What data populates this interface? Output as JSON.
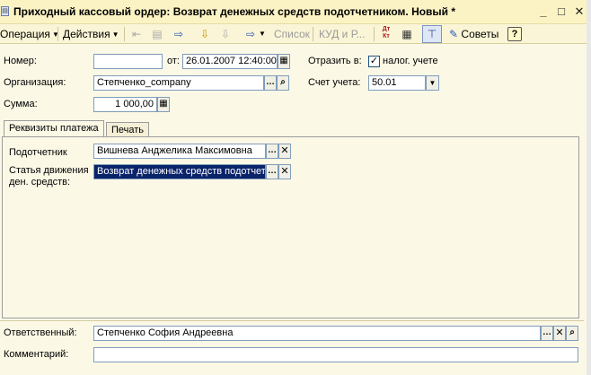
{
  "window": {
    "title": "Приходный кассовый ордер: Возврат денежных средств подотчетником. Новый *",
    "controls": {
      "minimize": "_",
      "maximize": "□",
      "close": "✕"
    }
  },
  "toolbar": {
    "operation_label": "Операция",
    "actions_label": "Действия",
    "list_label": "Список",
    "kud_label": "КУД и Р...",
    "dt_kt_label": "Дт Кт",
    "advice_label": "Советы",
    "help_label": "?"
  },
  "form": {
    "number_label": "Номер:",
    "number_value": "",
    "from_label": "от:",
    "date_value": "26.01.2007 12:40:00",
    "reflect_label": "Отразить в:",
    "tax_accounting_label": "налог. учете",
    "tax_accounting_checked": true,
    "organization_label": "Организация:",
    "organization_value": "Степченко_company",
    "account_label": "Счет учета:",
    "account_value": "50.01",
    "sum_label": "Сумма:",
    "sum_value": "1 000,00"
  },
  "tabs": [
    {
      "label": "Реквизиты платежа",
      "active": true
    },
    {
      "label": "Печать",
      "active": false
    }
  ],
  "payment": {
    "accountable_label": "Подотчетник",
    "accountable_value": "Вишнева Анджелика Максимовна",
    "cashflow_label_1": "Статья движения",
    "cashflow_label_2": "ден. средств:",
    "cashflow_value": "Возврат денежных средств подотчетн"
  },
  "footer": {
    "responsible_label": "Ответственный:",
    "responsible_value": "Степченко София Андреевна",
    "comment_label": "Комментарий:",
    "comment_value": ""
  },
  "icons": [
    "window-icon",
    "back-icon",
    "forward-icon",
    "document-icon",
    "calendar-icon",
    "calculator-icon",
    "search-icon",
    "clear-icon",
    "select-icon",
    "dropdown-icon",
    "dt-kt-icon",
    "report-icon",
    "structure-icon",
    "advice-icon",
    "help-icon"
  ]
}
